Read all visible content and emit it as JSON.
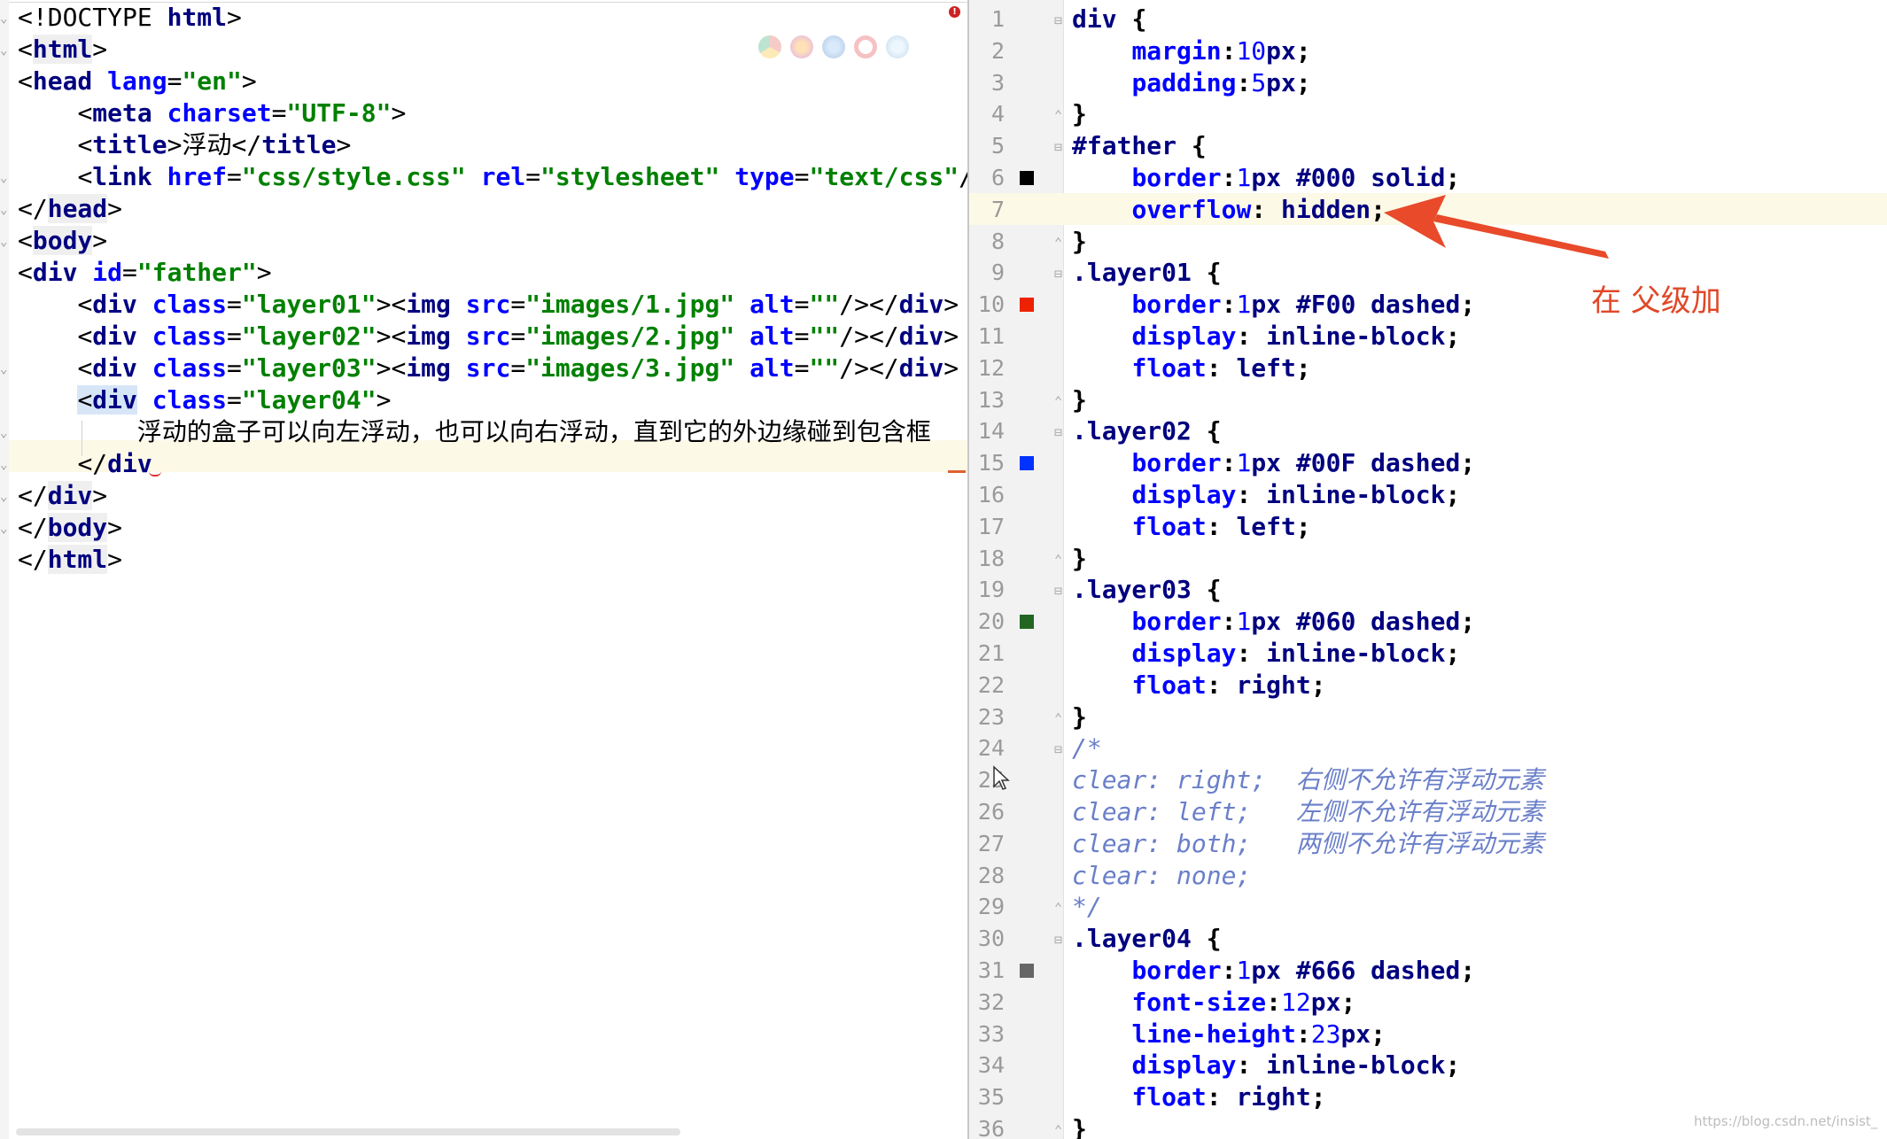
{
  "left_editor": {
    "lines": [
      {
        "type": "doctype",
        "text": "<!DOCTYPE html>"
      },
      {
        "type": "open",
        "tag": "html"
      },
      {
        "type": "head",
        "tag": "head",
        "attr": "lang",
        "value": "\"en\""
      },
      {
        "type": "meta",
        "tag": "meta",
        "attr": "charset",
        "value": "\"UTF-8\""
      },
      {
        "type": "title",
        "tag": "title",
        "content": "浮动"
      },
      {
        "type": "link",
        "tag": "link",
        "attrs": [
          [
            "href",
            "\"css/style.css\""
          ],
          [
            "rel",
            "\"stylesheet\""
          ],
          [
            "type",
            "\"text/css\""
          ]
        ],
        "tail": "/>"
      },
      {
        "type": "close",
        "tag": "head"
      },
      {
        "type": "open",
        "tag": "body"
      },
      {
        "type": "div-id",
        "tag": "div",
        "attr": "id",
        "value": "\"father\""
      },
      {
        "type": "div-img",
        "class": "\"layer01\"",
        "src": "\"images/1.jpg\"",
        "alt": "\"\""
      },
      {
        "type": "div-img",
        "class": "\"layer02\"",
        "src": "\"images/2.jpg\"",
        "alt": "\"\""
      },
      {
        "type": "div-img",
        "class": "\"layer03\"",
        "src": "\"images/3.jpg\"",
        "alt": "\"\""
      },
      {
        "type": "div-cls",
        "tag": "div",
        "class": "\"layer04\""
      },
      {
        "type": "cntext",
        "text": "浮动的盒子可以向左浮动，也可以向右浮动，直到它的外边缘碰到包含框"
      },
      {
        "type": "closediv",
        "text": "</div"
      },
      {
        "type": "close",
        "tag": "div"
      },
      {
        "type": "close",
        "tag": "body"
      },
      {
        "type": "close",
        "tag": "html"
      }
    ]
  },
  "right_editor": {
    "lines": [
      {
        "n": "1",
        "parts": [
          [
            "sel",
            "div "
          ],
          [
            "pun",
            "{"
          ]
        ]
      },
      {
        "n": "2",
        "indent": true,
        "parts": [
          [
            "prop",
            "margin"
          ],
          [
            "pun",
            ":"
          ],
          [
            "cnum",
            "10"
          ],
          [
            "cval",
            "px"
          ],
          [
            "pun",
            ";"
          ]
        ]
      },
      {
        "n": "3",
        "indent": true,
        "parts": [
          [
            "prop",
            "padding"
          ],
          [
            "pun",
            ":"
          ],
          [
            "cnum",
            "5"
          ],
          [
            "cval",
            "px"
          ],
          [
            "pun",
            ";"
          ]
        ]
      },
      {
        "n": "4",
        "parts": [
          [
            "pun",
            "}"
          ]
        ]
      },
      {
        "n": "5",
        "parts": [
          [
            "sel",
            "#father "
          ],
          [
            "pun",
            "{"
          ]
        ]
      },
      {
        "n": "6",
        "indent": true,
        "parts": [
          [
            "prop",
            "border"
          ],
          [
            "pun",
            ":"
          ],
          [
            "cnum",
            "1"
          ],
          [
            "cval",
            "px #000 solid"
          ],
          [
            "pun",
            ";"
          ]
        ],
        "swatch": "#000000"
      },
      {
        "n": "7",
        "indent": true,
        "parts": [
          [
            "prop",
            "overflow"
          ],
          [
            "pun",
            ": "
          ],
          [
            "cval",
            "hidden"
          ],
          [
            "pun",
            ";"
          ]
        ],
        "highlight": true
      },
      {
        "n": "8",
        "parts": [
          [
            "pun",
            "}"
          ]
        ]
      },
      {
        "n": "9",
        "parts": [
          [
            "sel",
            ".layer01 "
          ],
          [
            "pun",
            "{"
          ]
        ]
      },
      {
        "n": "10",
        "indent": true,
        "parts": [
          [
            "prop",
            "border"
          ],
          [
            "pun",
            ":"
          ],
          [
            "cnum",
            "1"
          ],
          [
            "cval",
            "px #F00 dashed"
          ],
          [
            "pun",
            ";"
          ]
        ],
        "swatch": "#ee2200"
      },
      {
        "n": "11",
        "indent": true,
        "parts": [
          [
            "prop",
            "display"
          ],
          [
            "pun",
            ": "
          ],
          [
            "cval",
            "inline-block"
          ],
          [
            "pun",
            ";"
          ]
        ]
      },
      {
        "n": "12",
        "indent": true,
        "parts": [
          [
            "prop",
            "float"
          ],
          [
            "pun",
            ": "
          ],
          [
            "cval",
            "left"
          ],
          [
            "pun",
            ";"
          ]
        ]
      },
      {
        "n": "13",
        "parts": [
          [
            "pun",
            "}"
          ]
        ]
      },
      {
        "n": "14",
        "parts": [
          [
            "sel",
            ".layer02 "
          ],
          [
            "pun",
            "{"
          ]
        ]
      },
      {
        "n": "15",
        "indent": true,
        "parts": [
          [
            "prop",
            "border"
          ],
          [
            "pun",
            ":"
          ],
          [
            "cnum",
            "1"
          ],
          [
            "cval",
            "px #00F dashed"
          ],
          [
            "pun",
            ";"
          ]
        ],
        "swatch": "#0033ff"
      },
      {
        "n": "16",
        "indent": true,
        "parts": [
          [
            "prop",
            "display"
          ],
          [
            "pun",
            ": "
          ],
          [
            "cval",
            "inline-block"
          ],
          [
            "pun",
            ";"
          ]
        ]
      },
      {
        "n": "17",
        "indent": true,
        "parts": [
          [
            "prop",
            "float"
          ],
          [
            "pun",
            ": "
          ],
          [
            "cval",
            "left"
          ],
          [
            "pun",
            ";"
          ]
        ]
      },
      {
        "n": "18",
        "parts": [
          [
            "pun",
            "}"
          ]
        ]
      },
      {
        "n": "19",
        "parts": [
          [
            "sel",
            ".layer03 "
          ],
          [
            "pun",
            "{"
          ]
        ]
      },
      {
        "n": "20",
        "indent": true,
        "parts": [
          [
            "prop",
            "border"
          ],
          [
            "pun",
            ":"
          ],
          [
            "cnum",
            "1"
          ],
          [
            "cval",
            "px #060 dashed"
          ],
          [
            "pun",
            ";"
          ]
        ],
        "swatch": "#226622"
      },
      {
        "n": "21",
        "indent": true,
        "parts": [
          [
            "prop",
            "display"
          ],
          [
            "pun",
            ": "
          ],
          [
            "cval",
            "inline-block"
          ],
          [
            "pun",
            ";"
          ]
        ]
      },
      {
        "n": "22",
        "indent": true,
        "parts": [
          [
            "prop",
            "float"
          ],
          [
            "pun",
            ": "
          ],
          [
            "cval",
            "right"
          ],
          [
            "pun",
            ";"
          ]
        ]
      },
      {
        "n": "23",
        "parts": [
          [
            "pun",
            "}"
          ]
        ]
      },
      {
        "n": "24",
        "parts": [
          [
            "cmt",
            "/*"
          ]
        ]
      },
      {
        "n": "25",
        "parts": [
          [
            "cmt",
            "clear: right;  "
          ],
          [
            "cmt-cn",
            "右侧不允许有浮动元素"
          ]
        ]
      },
      {
        "n": "26",
        "parts": [
          [
            "cmt",
            "clear: left;   "
          ],
          [
            "cmt-cn",
            "左侧不允许有浮动元素"
          ]
        ]
      },
      {
        "n": "27",
        "parts": [
          [
            "cmt",
            "clear: both;   "
          ],
          [
            "cmt-cn",
            "两侧不允许有浮动元素"
          ]
        ]
      },
      {
        "n": "28",
        "parts": [
          [
            "cmt",
            "clear: none;"
          ]
        ]
      },
      {
        "n": "29",
        "parts": [
          [
            "cmt",
            "*/"
          ]
        ]
      },
      {
        "n": "30",
        "parts": [
          [
            "sel",
            ".layer04 "
          ],
          [
            "pun",
            "{"
          ]
        ]
      },
      {
        "n": "31",
        "indent": true,
        "parts": [
          [
            "prop",
            "border"
          ],
          [
            "pun",
            ":"
          ],
          [
            "cnum",
            "1"
          ],
          [
            "cval",
            "px #666 dashed"
          ],
          [
            "pun",
            ";"
          ]
        ],
        "swatch": "#666666"
      },
      {
        "n": "32",
        "indent": true,
        "parts": [
          [
            "prop",
            "font-size"
          ],
          [
            "pun",
            ":"
          ],
          [
            "cnum",
            "12"
          ],
          [
            "cval",
            "px"
          ],
          [
            "pun",
            ";"
          ]
        ]
      },
      {
        "n": "33",
        "indent": true,
        "parts": [
          [
            "prop",
            "line-height"
          ],
          [
            "pun",
            ":"
          ],
          [
            "cnum",
            "23"
          ],
          [
            "cval",
            "px"
          ],
          [
            "pun",
            ";"
          ]
        ]
      },
      {
        "n": "34",
        "indent": true,
        "parts": [
          [
            "prop",
            "display"
          ],
          [
            "pun",
            ": "
          ],
          [
            "cval",
            "inline-block"
          ],
          [
            "pun",
            ";"
          ]
        ]
      },
      {
        "n": "35",
        "indent": true,
        "parts": [
          [
            "prop",
            "float"
          ],
          [
            "pun",
            ": "
          ],
          [
            "cval",
            "right"
          ],
          [
            "pun",
            ";"
          ]
        ]
      },
      {
        "n": "36",
        "parts": [
          [
            "pun",
            "}"
          ]
        ]
      }
    ]
  },
  "annotation": {
    "text": "在 父级加",
    "color": "#e04828"
  },
  "icons": {
    "error": "error-icon",
    "browsers": [
      "chrome-icon",
      "firefox-icon",
      "safari-icon",
      "opera-icon",
      "ie-icon"
    ]
  },
  "watermark": "https://blog.csdn.net/insist_"
}
